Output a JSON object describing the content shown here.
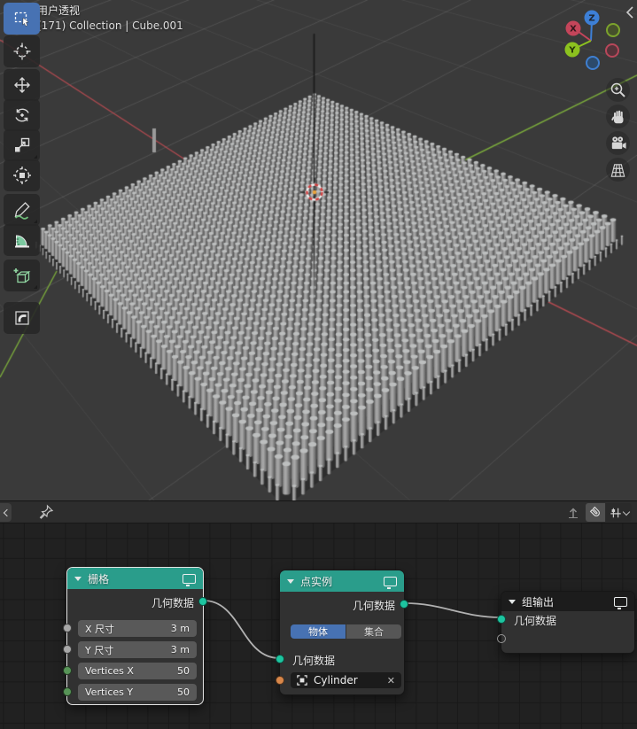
{
  "viewport": {
    "header": {
      "view_label": "用户透视",
      "context_label": "(171) Collection | Cube.001"
    },
    "toolbar": {
      "active_tool": "select-box",
      "tools": [
        "select-box",
        "cursor",
        "move",
        "rotate",
        "scale",
        "transform",
        "annotate",
        "measure",
        "add-cube",
        "corner"
      ]
    },
    "gizmo": {
      "axis_x_label": "X",
      "axis_y_label": "Y",
      "axis_z_label": "Z",
      "colors": {
        "x": "#c4455a",
        "y": "#8cc21f",
        "z": "#3d7fd6"
      }
    },
    "nav_icons": [
      "zoom-icon",
      "pan-hand-icon",
      "camera-view-icon",
      "toggle-perspective-icon"
    ],
    "colors": {
      "background": "#3a3a3a",
      "axis_x": "#b04a50",
      "axis_y": "#7aa93c"
    }
  },
  "node_editor": {
    "header_icons": [
      "collapse-chevron",
      "pin-icon",
      "parent-tree-icon",
      "snap-magnet-icon",
      "snap-options-icon"
    ],
    "colors": {
      "header_teal": "#2a9d8b",
      "socket_geometry": "#1dc5a0",
      "socket_float": "#a8a8a8",
      "socket_int": "#579457",
      "socket_object": "#d8874a",
      "toggle_active": "#4772b3"
    },
    "nodes": {
      "grid": {
        "title": "栅格",
        "selected": true,
        "outputs": [
          {
            "label": "几何数据",
            "type": "geometry"
          }
        ],
        "inputs": [
          {
            "label": "X 尺寸",
            "value": "3 m",
            "type": "float"
          },
          {
            "label": "Y 尺寸",
            "value": "3 m",
            "type": "float"
          },
          {
            "label": "Vertices X",
            "value": "50",
            "type": "int"
          },
          {
            "label": "Vertices Y",
            "value": "50",
            "type": "int"
          }
        ]
      },
      "instance_on_points": {
        "title": "点实例",
        "outputs": [
          {
            "label": "几何数据",
            "type": "geometry"
          }
        ],
        "toggle": {
          "options": [
            "物体",
            "集合"
          ],
          "selected": "物体"
        },
        "inputs": [
          {
            "label": "几何数据",
            "type": "geometry"
          }
        ],
        "object_field": {
          "value": "Cylinder",
          "icon": "object-cube-icon",
          "clear_label": "✕"
        }
      },
      "group_output": {
        "title": "组输出",
        "inputs": [
          {
            "label": "几何数据",
            "type": "geometry"
          }
        ]
      }
    }
  }
}
